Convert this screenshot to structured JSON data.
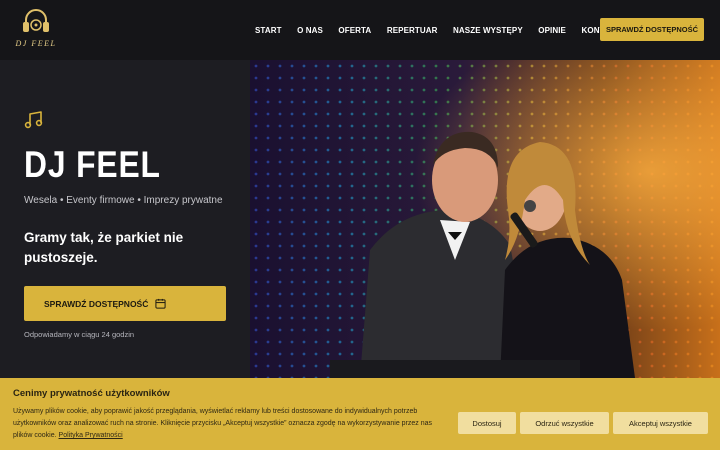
{
  "brand": {
    "logo_text": "DJ FEEL",
    "accent_color": "#d9b43c"
  },
  "nav": {
    "items": [
      "START",
      "O NAS",
      "OFERTA",
      "REPERTUAR",
      "NASZE WYSTĘPY",
      "OPINIE",
      "KONTAKT"
    ],
    "cta_label": "SPRAWDŹ DOSTĘPNOŚĆ"
  },
  "hero": {
    "icon": "music-note-icon",
    "title": "DJ FEEL",
    "subtitle": "Wesela • Eventy firmowe • Imprezy prywatne",
    "tagline": "Gramy tak, że parkiet nie pustoszeje.",
    "cta_label": "SPRAWDŹ DOSTĘPNOŚĆ",
    "cta_icon": "calendar-icon",
    "note": "Odpowiadamy w ciągu 24 godzin"
  },
  "cookie": {
    "title": "Cenimy prywatność użytkowników",
    "text": "Używamy plików cookie, aby poprawić jakość przeglądania, wyświetlać reklamy lub treści dostosowane do indywidualnych potrzeb użytkowników oraz analizować ruch na stronie. Kliknięcie przycisku „Akceptuj wszystkie” oznacza zgodę na wykorzystywanie przez nas plików cookie.",
    "link": "Polityka Prywatności",
    "buttons": {
      "customize": "Dostosuj",
      "reject": "Odrzuć wszystkie",
      "accept": "Akceptuj wszystkie"
    }
  }
}
